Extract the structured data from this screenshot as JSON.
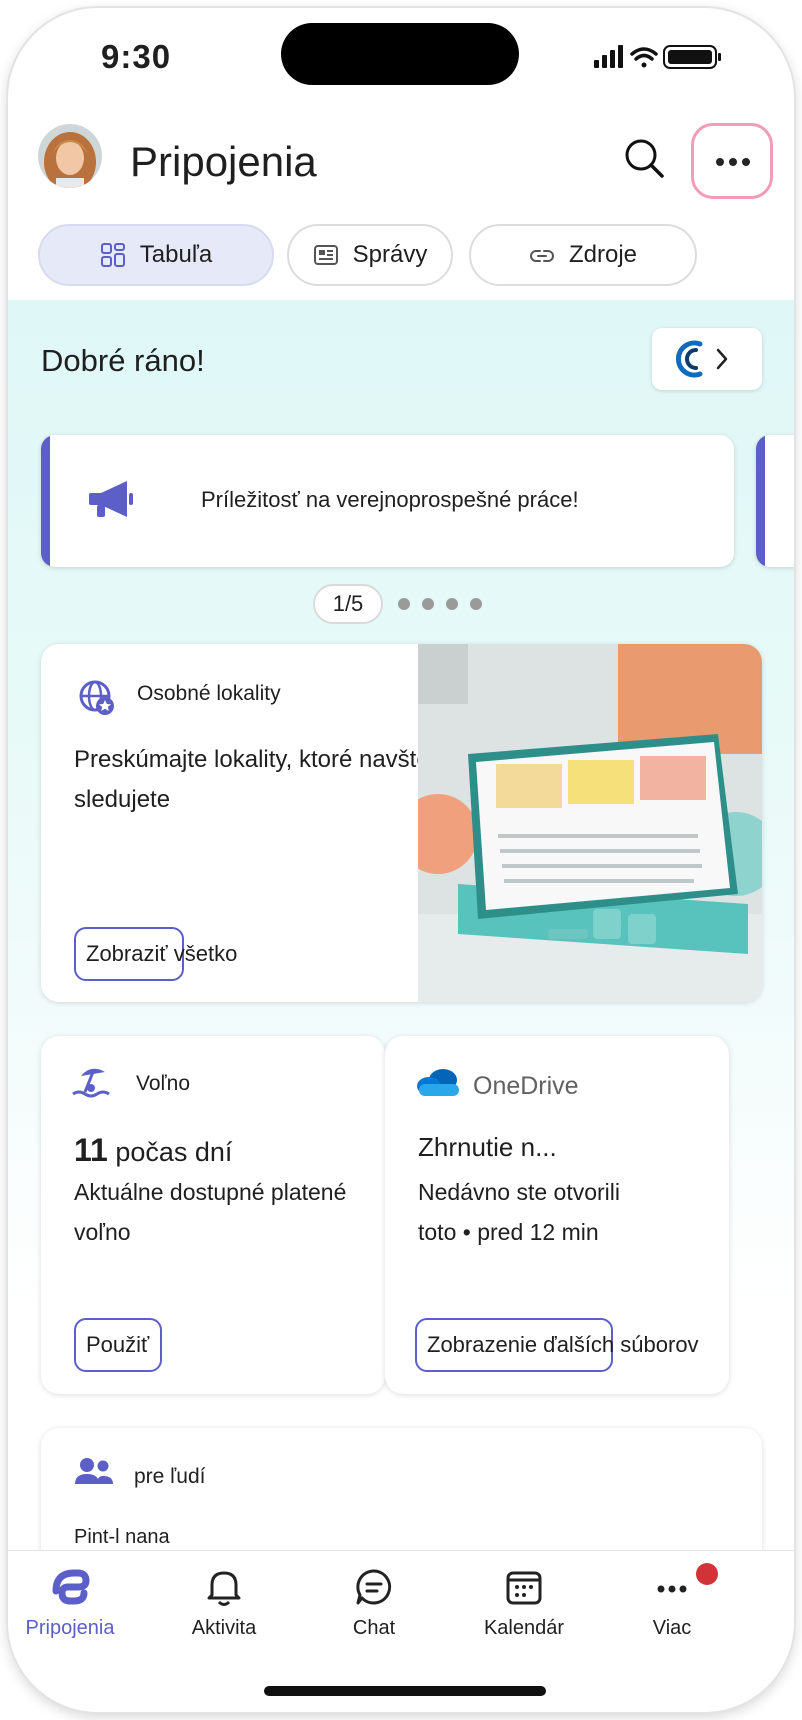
{
  "status_bar": {
    "time": "9:30"
  },
  "header": {
    "title": "Pripojenia"
  },
  "tabs": [
    {
      "label": "Tabuľa",
      "active": true
    },
    {
      "label": "Správy",
      "active": false
    },
    {
      "label": "Zdroje",
      "active": false
    }
  ],
  "greeting": "Dobré ráno!",
  "announcement": {
    "text": "Príležitosť na verejnoprospešné práce!"
  },
  "pager": {
    "label": "1/5"
  },
  "sites_card": {
    "label": "Osobné lokality",
    "title": "Preskúmajte lokality, ktoré navštevujete a sledujete",
    "button": "Zobraziť všetko"
  },
  "time_off_card": {
    "label": "Voľno",
    "count": "11",
    "count_unit": "počas dní",
    "description": "Aktuálne dostupné platené voľno",
    "button": "Použiť"
  },
  "onedrive_card": {
    "label": "OneDrive",
    "title": "Zhrnutie n...",
    "description": "Nedávno ste otvorili toto • pred 12 min",
    "button": "Zobrazenie ďalších súborov"
  },
  "people_card": {
    "label": "pre ľudí",
    "subtitle": "Pint-l nana"
  },
  "bottom_nav": [
    {
      "label": "Pripojenia",
      "icon": "connections-icon",
      "active": true
    },
    {
      "label": "Aktivita",
      "icon": "bell-icon"
    },
    {
      "label": "Chat",
      "icon": "chat-icon"
    },
    {
      "label": "Kalendár",
      "icon": "calendar-icon"
    },
    {
      "label": "Viac",
      "icon": "more-icon",
      "badge": true
    }
  ],
  "colors": {
    "accent": "#5b5fc7",
    "highlight": "#f49bb9",
    "badge": "#d13438"
  }
}
